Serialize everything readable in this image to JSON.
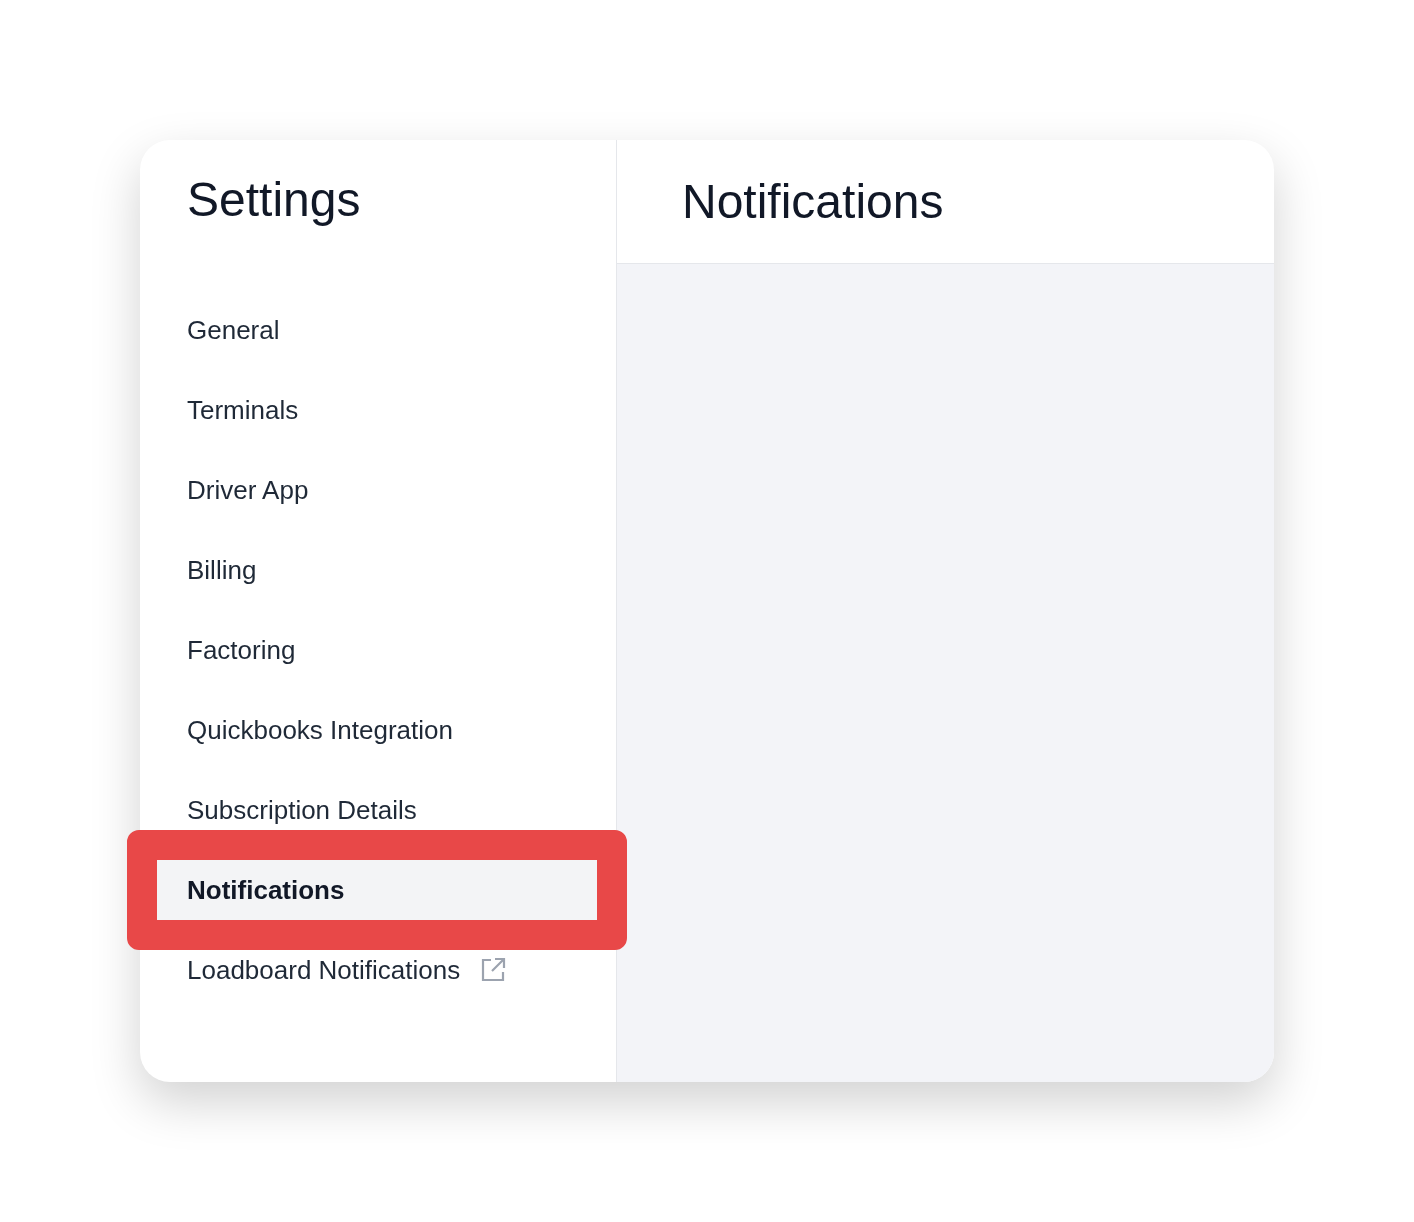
{
  "sidebar": {
    "title": "Settings",
    "items": [
      {
        "label": "General",
        "selected": false,
        "highlighted": false,
        "external": false
      },
      {
        "label": "Terminals",
        "selected": false,
        "highlighted": false,
        "external": false
      },
      {
        "label": "Driver App",
        "selected": false,
        "highlighted": false,
        "external": false
      },
      {
        "label": "Billing",
        "selected": false,
        "highlighted": false,
        "external": false
      },
      {
        "label": "Factoring",
        "selected": false,
        "highlighted": false,
        "external": false
      },
      {
        "label": "Quickbooks Integration",
        "selected": false,
        "highlighted": false,
        "external": false
      },
      {
        "label": "Subscription Details",
        "selected": false,
        "highlighted": false,
        "external": false
      },
      {
        "label": "Notifications",
        "selected": true,
        "highlighted": true,
        "external": false
      },
      {
        "label": "Loadboard Notifications",
        "selected": false,
        "highlighted": false,
        "external": true
      }
    ]
  },
  "main": {
    "title": "Notifications"
  }
}
